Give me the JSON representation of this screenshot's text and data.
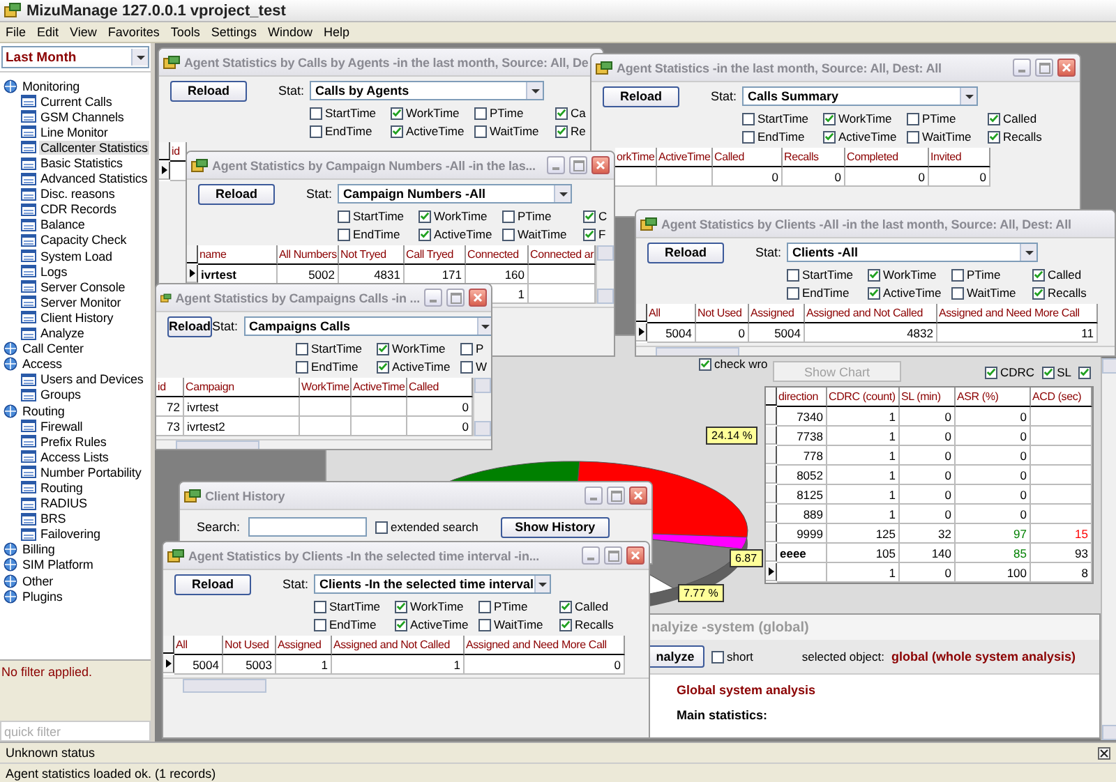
{
  "app": {
    "title": "MizuManage 127.0.0.1 vproject_test"
  },
  "menu": [
    "File",
    "Edit",
    "View",
    "Favorites",
    "Tools",
    "Settings",
    "Window",
    "Help"
  ],
  "sidebar": {
    "period": "Last Month",
    "tree": [
      {
        "label": "Monitoring",
        "selected": false,
        "children": [
          {
            "label": "Current Calls",
            "selected": false
          },
          {
            "label": "GSM Channels",
            "selected": false
          },
          {
            "label": "Line Monitor",
            "selected": false
          },
          {
            "label": "Callcenter Statistics",
            "selected": true
          },
          {
            "label": "Basic Statistics",
            "selected": false
          },
          {
            "label": "Advanced Statistics",
            "selected": false
          },
          {
            "label": "Disc. reasons",
            "selected": false
          },
          {
            "label": "CDR Records",
            "selected": false
          },
          {
            "label": "Balance",
            "selected": false
          },
          {
            "label": "Capacity Check",
            "selected": false
          },
          {
            "label": "System Load",
            "selected": false
          },
          {
            "label": "Logs",
            "selected": false
          },
          {
            "label": "Server Console",
            "selected": false
          },
          {
            "label": "Server Monitor",
            "selected": false
          },
          {
            "label": "Client History",
            "selected": false
          },
          {
            "label": "Analyze",
            "selected": false
          }
        ]
      },
      {
        "label": "Call Center",
        "selected": false
      },
      {
        "label": "Access",
        "selected": false,
        "children": [
          {
            "label": "Users and Devices",
            "selected": false
          },
          {
            "label": "Groups",
            "selected": false
          }
        ]
      },
      {
        "label": "Routing",
        "selected": false,
        "children": [
          {
            "label": "Firewall",
            "selected": false
          },
          {
            "label": "Prefix Rules",
            "selected": false
          },
          {
            "label": "Access Lists",
            "selected": false
          },
          {
            "label": "Number Portability",
            "selected": false
          },
          {
            "label": "Routing",
            "selected": false
          },
          {
            "label": "RADIUS",
            "selected": false
          },
          {
            "label": "BRS",
            "selected": false
          },
          {
            "label": "Failovering",
            "selected": false
          }
        ]
      },
      {
        "label": "Billing",
        "selected": false
      },
      {
        "label": "SIM Platform",
        "selected": false
      },
      {
        "label": "Other",
        "selected": false
      },
      {
        "label": "Plugins",
        "selected": false
      }
    ],
    "filter_status": "No filter applied.",
    "quick_filter": {
      "placeholder": "quick filter"
    }
  },
  "chart_panel": {
    "check": {
      "label": "check wro",
      "checked": true
    },
    "pie_labels": [
      "24.14 %",
      "6.87",
      "7.77 %"
    ],
    "show_chart": {
      "label": "Show Chart",
      "disabled": true
    },
    "toggles": [
      {
        "label": "CDRC",
        "checked": true
      },
      {
        "label": "SL",
        "checked": true
      },
      {
        "checked": true
      }
    ],
    "columns": [
      "direction",
      "CDRC (count)",
      "SL (min)",
      "ASR (%)",
      "ACD (sec)"
    ],
    "rows": [
      {
        "cells": [
          "7340",
          "1",
          "0",
          "0",
          ""
        ],
        "current": false
      },
      {
        "cells": [
          "7738",
          "1",
          "0",
          "0",
          ""
        ],
        "current": false
      },
      {
        "cells": [
          "778",
          "1",
          "0",
          "0",
          ""
        ],
        "current": false
      },
      {
        "cells": [
          "8052",
          "1",
          "0",
          "0",
          ""
        ],
        "current": false
      },
      {
        "cells": [
          "8125",
          "1",
          "0",
          "0",
          ""
        ],
        "current": false
      },
      {
        "cells": [
          "889",
          "1",
          "0",
          "0",
          ""
        ],
        "current": false
      },
      {
        "cells": [
          "9999",
          "125",
          "32",
          {
            "text": "97",
            "color": "#008000"
          },
          {
            "text": "15",
            "color": "#ff0000"
          }
        ],
        "current": false
      },
      {
        "cells": [
          "eeee",
          "105",
          "140",
          {
            "text": "85",
            "color": "#008000"
          },
          "93"
        ],
        "current": false
      },
      {
        "cells": [
          "",
          "1",
          "0",
          "100",
          "8"
        ],
        "current": true
      }
    ]
  },
  "analyze_panel": {
    "title": "nalyize -system (global)",
    "button": "nalyze",
    "short": {
      "label": "short",
      "checked": false
    },
    "selected_label": "selected object:",
    "selected_value": "global (whole system analysis)",
    "heading": "Global system analysis",
    "subheading": "Main statistics:"
  },
  "windows": [
    {
      "kind": "stats",
      "title": "Agent Statistics by Calls by Agents -in the last month, Source: All, De",
      "buttons": false,
      "reload": "Reload",
      "stat_label": "Stat:",
      "stat": "Calls by Agents",
      "checkboxes": [
        {
          "label": "StartTime",
          "checked": false
        },
        {
          "label": "WorkTime",
          "checked": true
        },
        {
          "label": "PTime",
          "checked": false
        },
        {
          "label": "Ca",
          "checked": true
        },
        {
          "label": "EndTime",
          "checked": false
        },
        {
          "label": "ActiveTime",
          "checked": true
        },
        {
          "label": "WaitTime",
          "checked": false
        },
        {
          "label": "Re",
          "checked": true
        }
      ],
      "columns": [
        "id"
      ],
      "rows": [
        {
          "cells": [
            ""
          ],
          "current": true
        }
      ]
    },
    {
      "kind": "stats",
      "title": "Agent Statistics -in the last month, Source: All, Dest: All",
      "buttons": true,
      "reload": "Reload",
      "stat_label": "Stat:",
      "stat": "Calls Summary",
      "checkboxes": [
        {
          "label": "StartTime",
          "checked": false
        },
        {
          "label": "WorkTime",
          "checked": true
        },
        {
          "label": "PTime",
          "checked": false
        },
        {
          "label": "Called",
          "checked": true
        },
        {
          "label": "EndTime",
          "checked": false
        },
        {
          "label": "ActiveTime",
          "checked": true
        },
        {
          "label": "WaitTime",
          "checked": false
        },
        {
          "label": "Recalls",
          "checked": true
        }
      ],
      "columns": [
        "orkTime",
        "ActiveTime",
        "Called",
        "Recalls",
        "Completed",
        "Invited"
      ],
      "rows": [
        {
          "cells": [
            "",
            "",
            "0",
            "0",
            "0",
            "0"
          ]
        }
      ]
    },
    {
      "kind": "stats",
      "title": "Agent Statistics by Campaign Numbers -All -in the las...",
      "buttons": true,
      "reload": "Reload",
      "stat_label": "Stat:",
      "stat": "Campaign Numbers -All",
      "checkboxes": [
        {
          "label": "StartTime",
          "checked": false
        },
        {
          "label": "WorkTime",
          "checked": true
        },
        {
          "label": "PTime",
          "checked": false
        },
        {
          "label": "C",
          "checked": true
        },
        {
          "label": "EndTime",
          "checked": false
        },
        {
          "label": "ActiveTime",
          "checked": true
        },
        {
          "label": "WaitTime",
          "checked": false
        },
        {
          "label": "F",
          "checked": true
        }
      ],
      "columns": [
        "name",
        "All Numbers",
        "Not Tryed",
        "Call Tryed",
        "Connected",
        "Connected ar"
      ],
      "rows": [
        {
          "cells": [
            "ivrtest",
            "5002",
            "4831",
            "171",
            "160",
            ""
          ],
          "current": true
        },
        {
          "cells": [
            "",
            "",
            "",
            "",
            "1",
            ""
          ]
        }
      ]
    },
    {
      "kind": "stats",
      "title": "Agent Statistics by Campaigns Calls -in ...",
      "buttons": true,
      "reload": "Reload",
      "stat_label": "Stat:",
      "stat": "Campaigns Calls",
      "checkboxes": [
        {
          "label": "StartTime",
          "checked": false
        },
        {
          "label": "WorkTime",
          "checked": true
        },
        {
          "label": "P",
          "checked": false
        },
        {
          "label": "EndTime",
          "checked": false
        },
        {
          "label": "ActiveTime",
          "checked": true
        },
        {
          "label": "W",
          "checked": false
        }
      ],
      "columns": [
        "id",
        "Campaign",
        "WorkTime",
        "ActiveTime",
        "Called"
      ],
      "rows": [
        {
          "cells": [
            "72",
            "ivrtest",
            "",
            "",
            "0"
          ]
        },
        {
          "cells": [
            "73",
            "ivrtest2",
            "",
            "",
            "0"
          ]
        }
      ]
    },
    {
      "kind": "stats",
      "title": "Agent Statistics by Clients -All -in the last month, Source: All, Dest: All",
      "buttons": false,
      "reload": "Reload",
      "stat_label": "Stat:",
      "stat": "Clients -All",
      "checkboxes": [
        {
          "label": "StartTime",
          "checked": false
        },
        {
          "label": "WorkTime",
          "checked": true
        },
        {
          "label": "PTime",
          "checked": false
        },
        {
          "label": "Called",
          "checked": true
        },
        {
          "label": "EndTime",
          "checked": false
        },
        {
          "label": "ActiveTime",
          "checked": true
        },
        {
          "label": "WaitTime",
          "checked": false
        },
        {
          "label": "Recalls",
          "checked": true
        }
      ],
      "columns": [
        "All",
        "Not Used",
        "Assigned",
        "Assigned and Not Called",
        "Assigned and Need More Call"
      ],
      "rows": [
        {
          "cells": [
            "5004",
            "0",
            "5004",
            "4832",
            "11"
          ],
          "current": true
        }
      ]
    },
    {
      "kind": "search",
      "title": "Client History",
      "buttons": true,
      "search_label": "Search:",
      "extended": {
        "label": "extended search",
        "checked": false
      },
      "action": "Show History"
    },
    {
      "kind": "stats",
      "title": "Agent Statistics by Clients -In the selected time interval -in...",
      "buttons": true,
      "reload": "Reload",
      "stat_label": "Stat:",
      "stat": "Clients -In the selected time interval",
      "checkboxes": [
        {
          "label": "StartTime",
          "checked": false
        },
        {
          "label": "WorkTime",
          "checked": true
        },
        {
          "label": "PTime",
          "checked": false
        },
        {
          "label": "Called",
          "checked": true
        },
        {
          "label": "EndTime",
          "checked": false
        },
        {
          "label": "ActiveTime",
          "checked": true
        },
        {
          "label": "WaitTime",
          "checked": false
        },
        {
          "label": "Recalls",
          "checked": true
        }
      ],
      "columns": [
        "All",
        "Not Used",
        "Assigned",
        "Assigned and Not Called",
        "Assigned and Need More Call"
      ],
      "rows": [
        {
          "cells": [
            "5004",
            "5003",
            "1",
            "1",
            "0"
          ],
          "current": true
        }
      ]
    }
  ],
  "status_bar": [
    "Unknown status",
    "Agent statistics loaded ok. (1 records)"
  ]
}
